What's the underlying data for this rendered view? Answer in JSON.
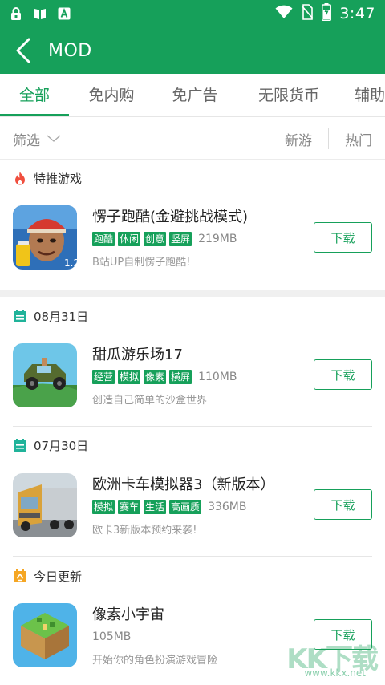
{
  "status_bar": {
    "time": "3:47",
    "left_icons": [
      "lock-icon",
      "book-icon",
      "text-a-icon"
    ],
    "right_icons": [
      "wifi-icon",
      "no-sim-icon",
      "battery-charging-icon"
    ]
  },
  "header": {
    "title": "MOD",
    "back_icon": "chevron-left-icon"
  },
  "tabs": [
    {
      "label": "全部",
      "active": true
    },
    {
      "label": "免内购",
      "active": false
    },
    {
      "label": "免广告",
      "active": false
    },
    {
      "label": "无限货币",
      "active": false
    },
    {
      "label": "辅助",
      "active": false
    }
  ],
  "filter": {
    "label": "筛选",
    "sort_new": "新游",
    "sort_hot": "热门"
  },
  "sections": [
    {
      "title": "特推游戏",
      "icon": "flame-icon",
      "apps": [
        {
          "name": "愣子跑酷(金避挑战模式)",
          "tags": [
            "跑酷",
            "休闲",
            "创意",
            "竖屏"
          ],
          "size": "219MB",
          "desc": "B站UP自制愣子跑酷!",
          "button": "下载"
        }
      ]
    },
    {
      "title": "08月31日",
      "icon": "calendar-icon",
      "apps": [
        {
          "name": "甜瓜游乐场17",
          "tags": [
            "经营",
            "模拟",
            "像素",
            "横屏"
          ],
          "size": "110MB",
          "desc": "创造自己简单的沙盒世界",
          "button": "下载"
        }
      ]
    },
    {
      "title": "07月30日",
      "icon": "calendar-icon",
      "apps": [
        {
          "name": "欧洲卡车模拟器3（新版本）",
          "tags": [
            "模拟",
            "赛车",
            "生活",
            "高画质"
          ],
          "size": "336MB",
          "desc": "欧卡3新版本预约来袭!",
          "button": "下载"
        }
      ]
    },
    {
      "title": "今日更新",
      "icon": "today-icon",
      "apps": [
        {
          "name": "像素小宇宙",
          "tags": [],
          "size": "105MB",
          "desc": "开始你的角色扮演游戏冒险",
          "button": "下载"
        }
      ]
    }
  ],
  "watermark": {
    "brand": "KK下载",
    "url": "www.kkx.net"
  },
  "colors": {
    "primary": "#16a05a",
    "flame": "#f04e3e",
    "calendar": "#20b39a",
    "today": "#f5a623"
  }
}
